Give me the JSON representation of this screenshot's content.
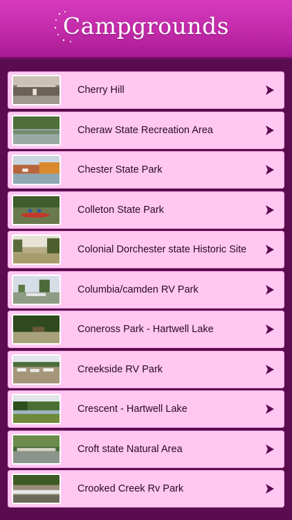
{
  "header": {
    "title": "Campgrounds"
  },
  "list": [
    {
      "label": "Cherry Hill",
      "thumb_icon": "mall-interior-photo"
    },
    {
      "label": "Cheraw State Recreation Area",
      "thumb_icon": "lake-trees-photo"
    },
    {
      "label": "Chester State Park",
      "thumb_icon": "lake-autumn-photo"
    },
    {
      "label": "Colleton State Park",
      "thumb_icon": "canoe-river-photo"
    },
    {
      "label": "Colonial Dorchester state Historic Site",
      "thumb_icon": "field-trees-photo"
    },
    {
      "label": "Columbia/camden RV Park",
      "thumb_icon": "rv-park-photo"
    },
    {
      "label": "Coneross Park - Hartwell Lake",
      "thumb_icon": "forest-campsite-photo"
    },
    {
      "label": "Creekside RV Park",
      "thumb_icon": "rv-lot-photo"
    },
    {
      "label": "Crescent - Hartwell Lake",
      "thumb_icon": "lakeshore-photo"
    },
    {
      "label": "Croft state Natural Area",
      "thumb_icon": "bridge-photo"
    },
    {
      "label": "Crooked Creek Rv Park",
      "thumb_icon": "creek-rocks-photo"
    }
  ],
  "colors": {
    "header": "#c22aa9",
    "background": "#5b0c4f",
    "row": "#ffc7f2",
    "chevron": "#5a0a4e"
  }
}
